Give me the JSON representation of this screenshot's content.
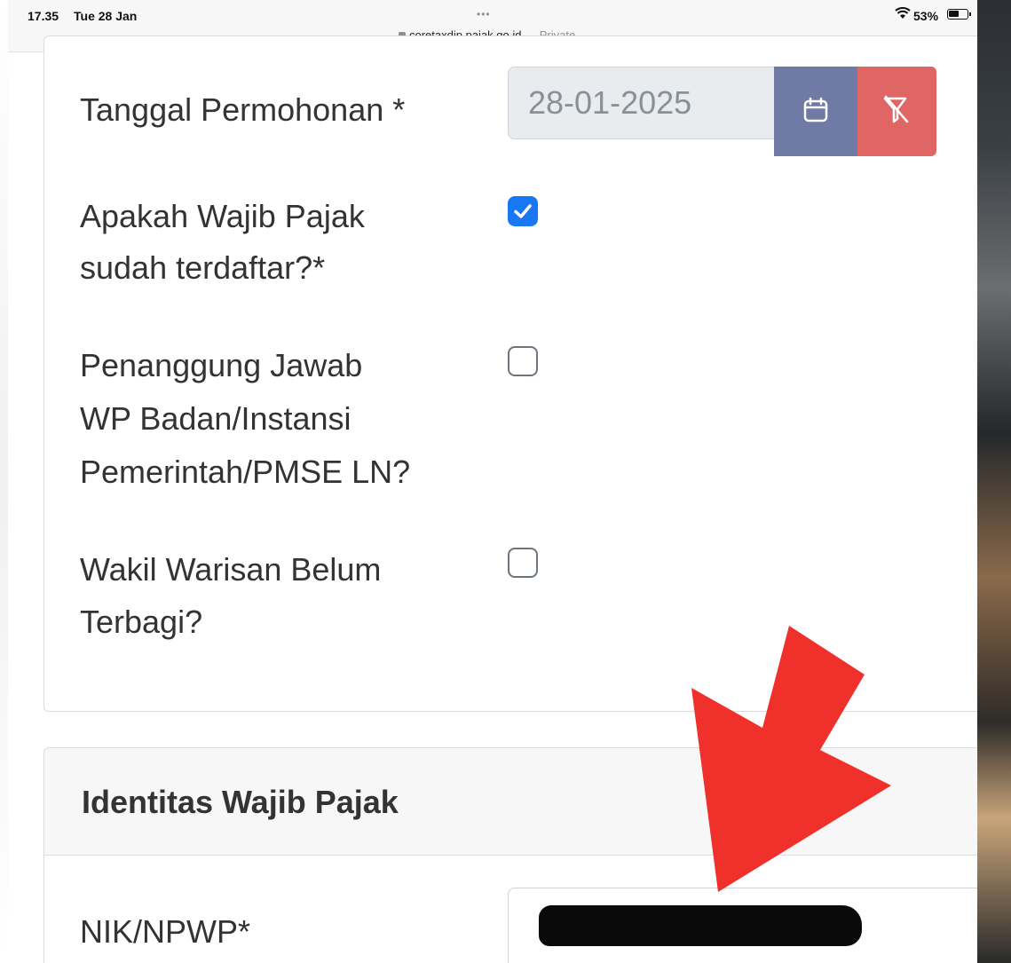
{
  "status_bar": {
    "time": "17.35",
    "date": "Tue 28 Jan",
    "dots": "•••",
    "url": "coretaxdjp.pajak.go.id",
    "url_suffix": " — Private",
    "battery": "53%",
    "icons": [
      "lock-icon",
      "wifi-icon",
      "battery-icon"
    ]
  },
  "form": {
    "tanggal_label": "Tanggal Permohonan *",
    "tanggal_value": "28-01-2025",
    "calendar_icon": "calendar-icon",
    "clear_icon": "filter-clear-icon",
    "terdaftar_label_line1": "Apakah Wajib Pajak",
    "terdaftar_label_line2": "sudah terdaftar?*",
    "terdaftar_checked": true,
    "penanggung_label_line1": "Penanggung Jawab",
    "penanggung_label_line2": "WP Badan/Instansi",
    "penanggung_label_line3": "Pemerintah/PMSE LN?",
    "penanggung_checked": false,
    "wakil_label_line1": "Wakil Warisan Belum",
    "wakil_label_line2": "Terbagi?",
    "wakil_checked": false
  },
  "identitas": {
    "section_title": "Identitas Wajib Pajak",
    "nik_label": "NIK/NPWP*"
  },
  "colors": {
    "calendar_button": "#6f7aa5",
    "clear_button": "#e06666",
    "checkbox_checked": "#1877f2",
    "arrow": "#f0302a"
  }
}
